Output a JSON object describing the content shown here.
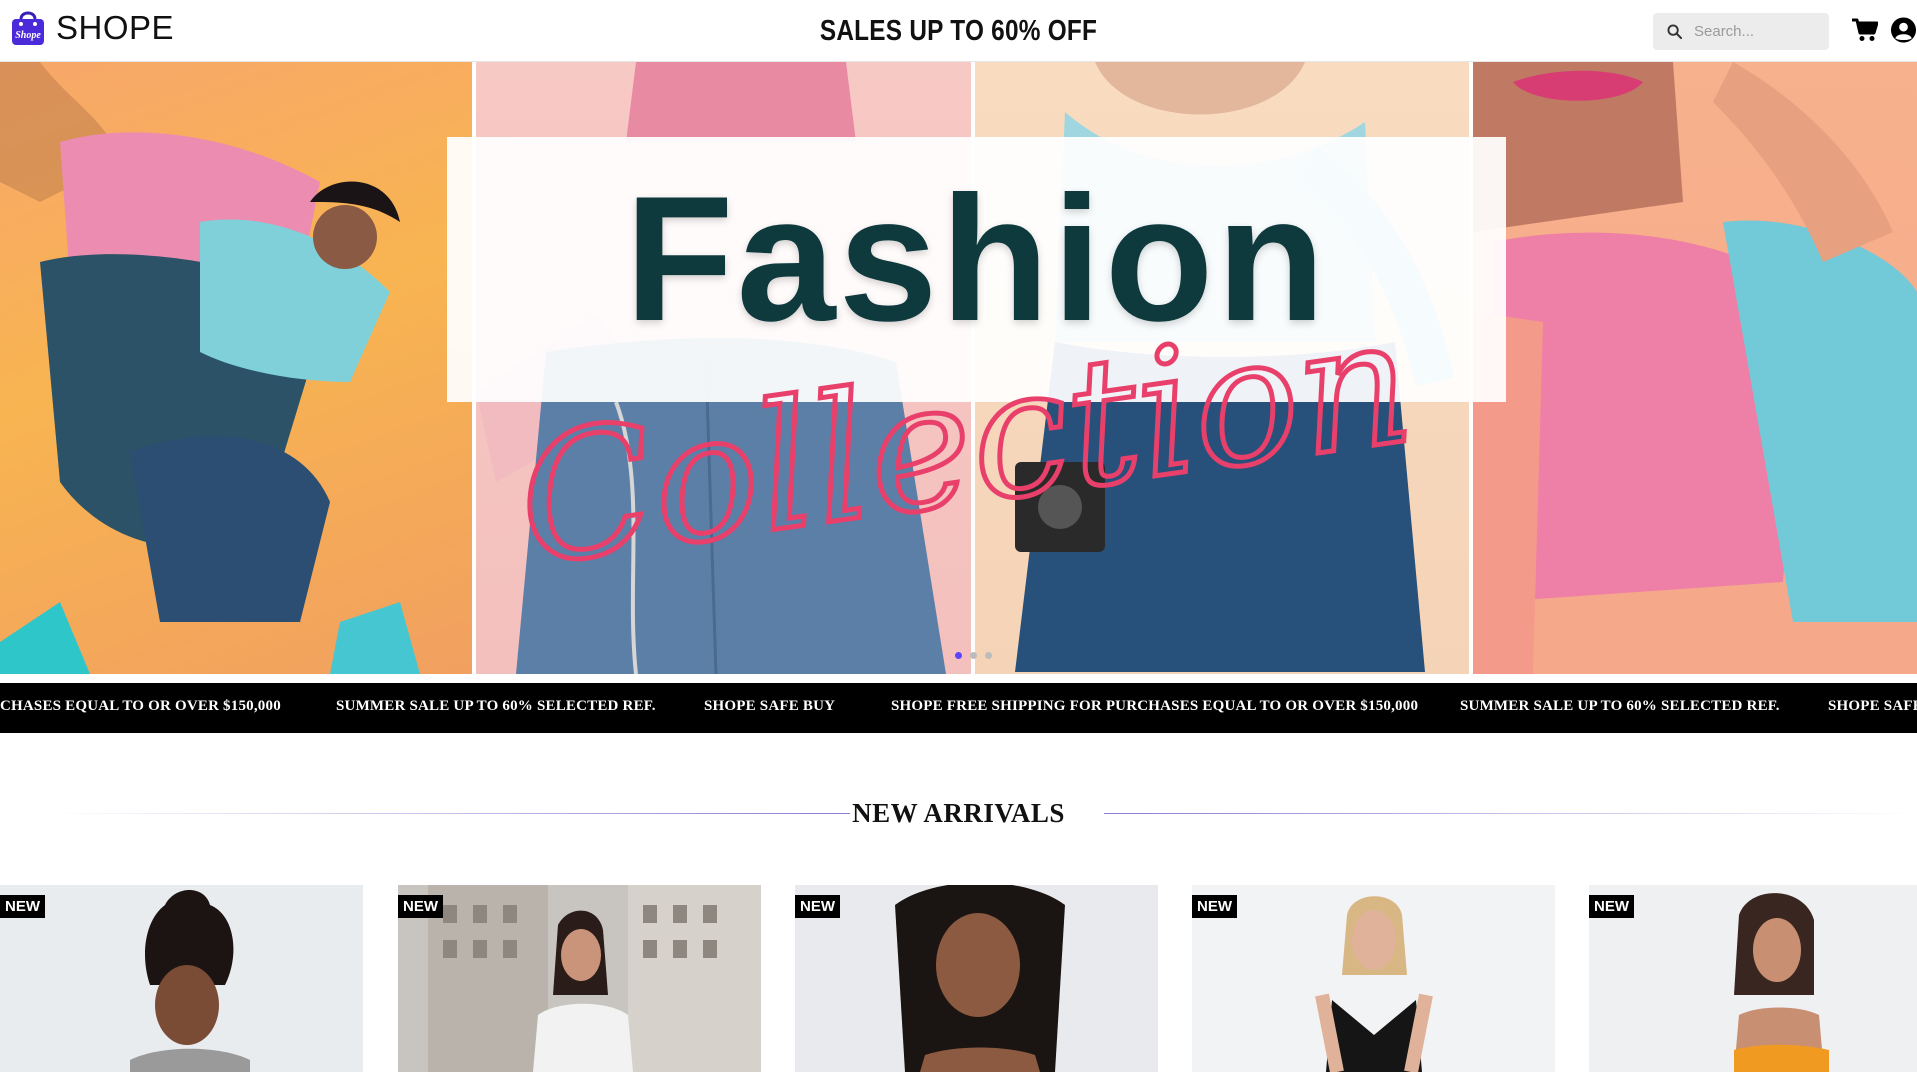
{
  "header": {
    "brand": "SHOPE",
    "logo_mark_text": "Shope",
    "promo": "SALES UP TO 60% OFF",
    "search_placeholder": "Search...",
    "cart_icon": "cart-icon",
    "user_icon": "user-icon"
  },
  "hero": {
    "title": "Fashion",
    "script": "Collection",
    "slides": 4,
    "active_slide": 1
  },
  "marquee": {
    "items": [
      "CHASES EQUAL TO OR OVER $150,000",
      "SUMMER SALE UP TO 60% SELECTED REF.",
      "SHOPE SAFE BUY",
      "SHOPE FREE SHIPPING FOR PURCHASES EQUAL TO OR OVER $150,000",
      "SUMMER SALE UP TO 60% SELECTED REF.",
      "SHOPE SAFE"
    ]
  },
  "new_arrivals": {
    "title": "NEW ARRIVALS",
    "products": [
      {
        "badge": "NEW"
      },
      {
        "badge": "NEW"
      },
      {
        "badge": "NEW"
      },
      {
        "badge": "NEW"
      },
      {
        "badge": "NEW"
      }
    ]
  },
  "colors": {
    "brand_purple": "#4b2bd9",
    "title_teal": "#0e3a3e",
    "script_pink": "#e8406b",
    "carousel_active": "#5b45ff"
  }
}
